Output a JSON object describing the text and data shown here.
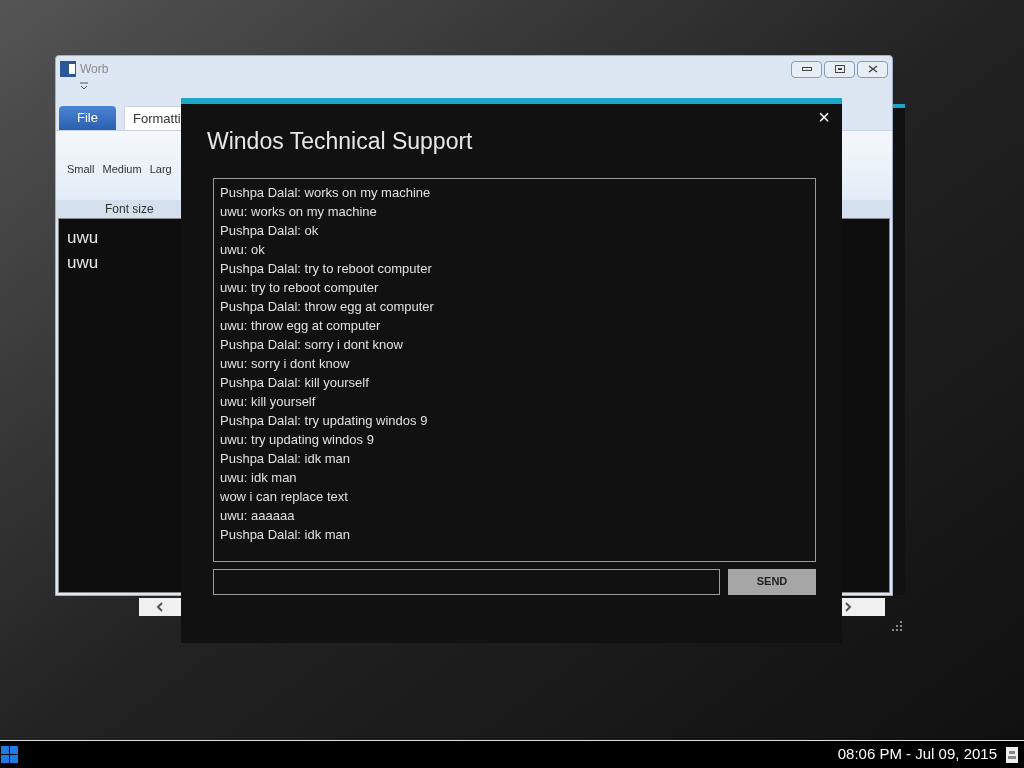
{
  "app_window": {
    "title": "Worb",
    "tabs": [
      {
        "label": "File",
        "kind": "menu",
        "selected": false
      },
      {
        "label": "Formatti",
        "kind": "tab",
        "selected": true
      }
    ],
    "ribbon": {
      "buttons": [
        "Small",
        "Medium",
        "Larg"
      ],
      "group_label": "Font size"
    },
    "document_lines": [
      "uwu",
      "uwu"
    ]
  },
  "dialog": {
    "title": "Windos Technical Support",
    "close": "×",
    "messages": [
      "Pushpa Dalal: works on my machine",
      "uwu: works on my machine",
      "Pushpa Dalal: ok",
      "uwu: ok",
      "Pushpa Dalal: try to reboot computer",
      "uwu: try to reboot computer",
      "Pushpa Dalal: throw egg at computer",
      "uwu: throw egg at computer",
      "Pushpa Dalal: sorry i dont know",
      "uwu: sorry i dont know",
      "Pushpa Dalal: kill yourself",
      "uwu: kill yourself",
      "Pushpa Dalal: try updating windos 9",
      "uwu: try updating windos 9",
      "Pushpa Dalal: idk man",
      "uwu: idk man",
      "wow i can replace text",
      "uwu: aaaaaa",
      "Pushpa Dalal: idk man"
    ],
    "send_button": "SEND"
  },
  "taskbar": {
    "clock": "08:06 PM - Jul 09, 2015"
  }
}
